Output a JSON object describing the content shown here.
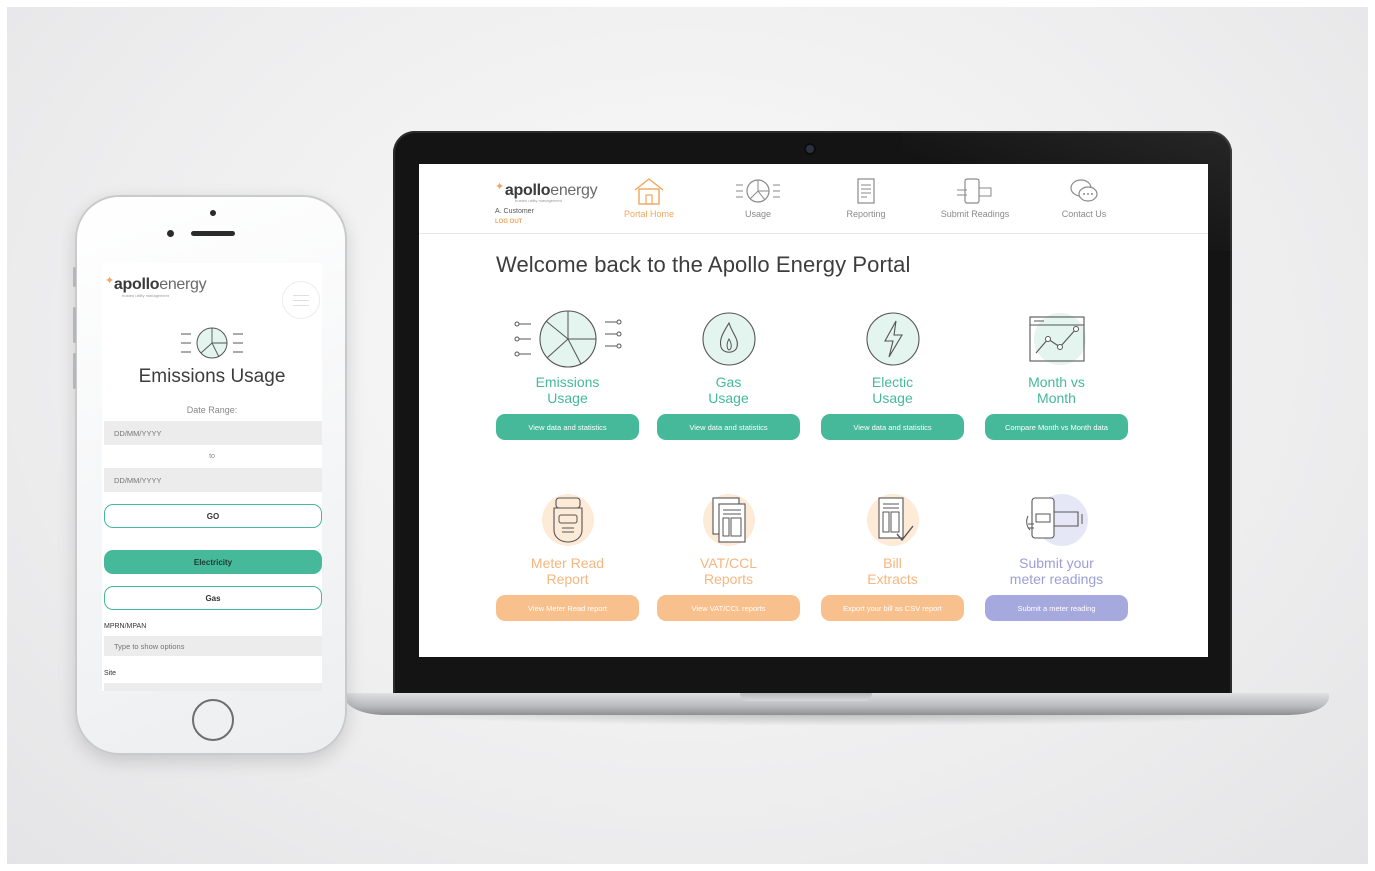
{
  "portal": {
    "logo": {
      "bold": "apollo",
      "light": "energy",
      "sub": "trusted utility management"
    },
    "user_name": "A. Customer",
    "logout_label": "LOG OUT",
    "nav": [
      {
        "label": "Portal Home",
        "icon": "house-icon",
        "active": true
      },
      {
        "label": "Usage",
        "icon": "pie-chart-icon",
        "active": false
      },
      {
        "label": "Reporting",
        "icon": "document-icon",
        "active": false
      },
      {
        "label": "Submit Readings",
        "icon": "phone-hand-icon",
        "active": false
      },
      {
        "label": "Contact Us",
        "icon": "chat-bubbles-icon",
        "active": false
      }
    ],
    "welcome": "Welcome back to the Apollo Energy Portal",
    "tiles": [
      {
        "line1": "Emissions",
        "line2": "Usage",
        "button": "View data and statistics",
        "icon": "pie-chart-icon",
        "color": "#45b99a"
      },
      {
        "line1": "Gas",
        "line2": "Usage",
        "button": "View data and statistics",
        "icon": "flame-icon",
        "color": "#45b99a"
      },
      {
        "line1": "Electic",
        "line2": "Usage",
        "button": "View data and statistics",
        "icon": "lightning-icon",
        "color": "#45b99a"
      },
      {
        "line1": "Month vs",
        "line2": "Month",
        "button": "Compare Month vs Month data",
        "icon": "line-chart-icon",
        "color": "#45b99a"
      },
      {
        "line1": "Meter Read",
        "line2": "Report",
        "button": "View Meter Read report",
        "icon": "meter-icon",
        "color": "#f8c08d"
      },
      {
        "line1": "VAT/CCL",
        "line2": "Reports",
        "button": "View VAT/CCL reports",
        "icon": "documents-icon",
        "color": "#f8c08d"
      },
      {
        "line1": "Bill",
        "line2": "Extracts",
        "button": "Export your bill as CSV report",
        "icon": "bill-check-icon",
        "color": "#f8c08d"
      },
      {
        "line1": "Submit your",
        "line2": "meter readings",
        "button": "Submit a meter reading",
        "icon": "phone-hand-icon",
        "color": "#a6a9dd"
      }
    ]
  },
  "mobile": {
    "logo": {
      "bold": "apollo",
      "light": "energy",
      "sub": "trusted utility management"
    },
    "title": "Emissions Usage",
    "date_range_label": "Date Range:",
    "date_from_placeholder": "DD/MM/YYYY",
    "to_label": "to",
    "date_to_placeholder": "DD/MM/YYYY",
    "go_label": "GO",
    "electricity_label": "Electricity",
    "gas_label": "Gas",
    "mprn_label": "MPRN/MPAN",
    "mprn_placeholder": "Type to show options",
    "site_label": "Site"
  },
  "colors": {
    "teal": "#45b99a",
    "orange": "#f8c08d",
    "purple": "#a6a9dd",
    "active_nav": "#f2a65a"
  }
}
